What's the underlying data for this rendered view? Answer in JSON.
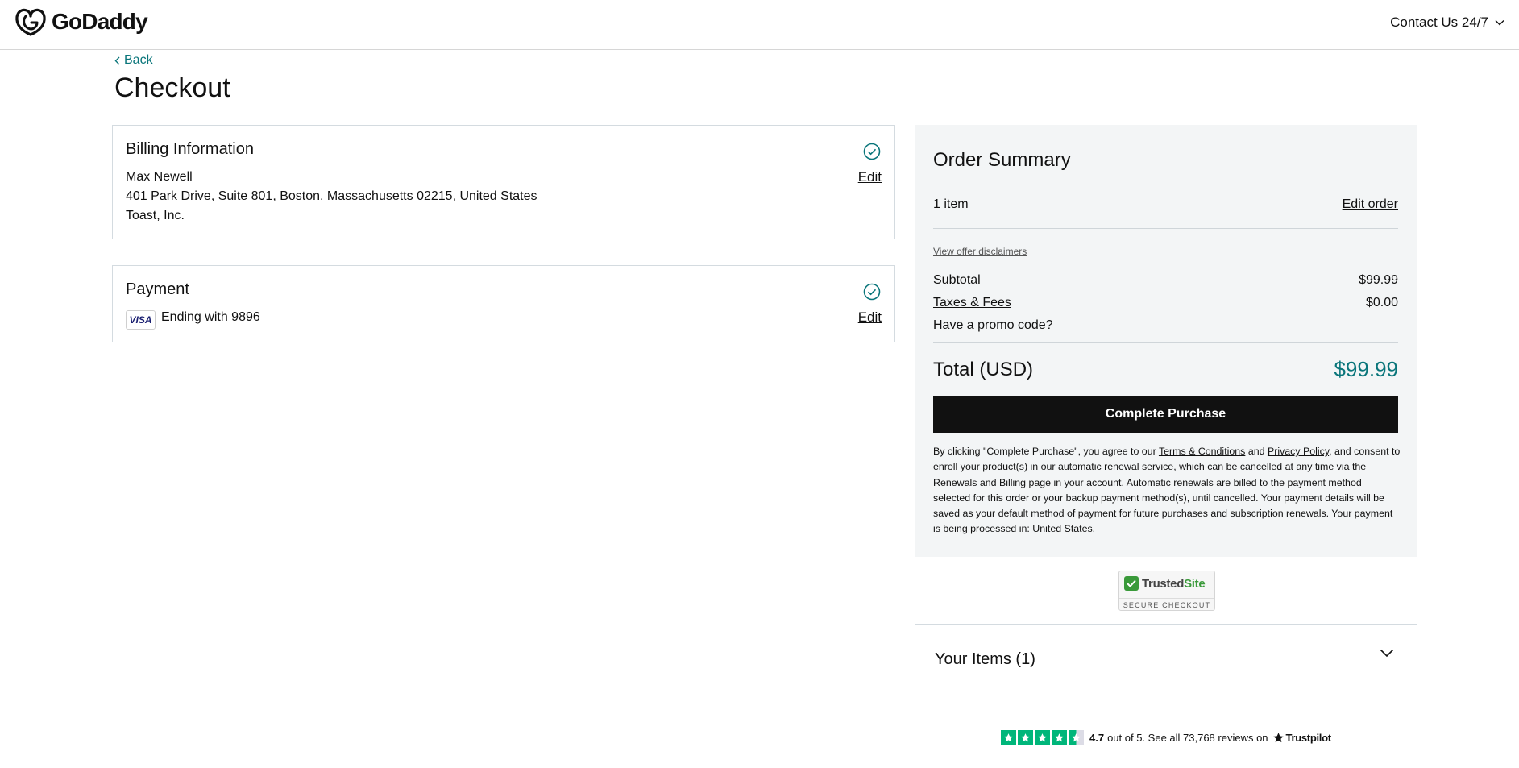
{
  "header": {
    "brand": "GoDaddy",
    "contact_label": "Contact Us 24/7",
    "icons": {
      "logo": "godaddy-logo-icon",
      "contact_dropdown": "chevron-down-icon"
    }
  },
  "nav": {
    "back_label": "Back"
  },
  "page": {
    "title": "Checkout"
  },
  "billing": {
    "title": "Billing Information",
    "name": "Max Newell",
    "address": "401 Park Drive, Suite 801, Boston, Massachusetts 02215, United States",
    "company": "Toast, Inc.",
    "edit_label": "Edit",
    "status_icon": "check-circle-icon"
  },
  "payment": {
    "title": "Payment",
    "card_brand": "VISA",
    "card_text": "Ending with 9896",
    "edit_label": "Edit",
    "status_icon": "check-circle-icon"
  },
  "summary": {
    "title": "Order Summary",
    "item_count": "1 item",
    "edit_order_label": "Edit order",
    "disclaimers_label": "View offer disclaimers",
    "subtotal_label": "Subtotal",
    "subtotal_value": "$99.99",
    "taxes_label": "Taxes & Fees",
    "taxes_value": "$0.00",
    "promo_label": "Have a promo code?",
    "total_label": "Total (USD)",
    "total_value": "$99.99",
    "complete_label": "Complete Purchase",
    "legal": {
      "part1": "By clicking \"Complete Purchase\", you agree to our ",
      "terms_link": "Terms & Conditions",
      "part2": " and ",
      "privacy_link": "Privacy Policy",
      "part3": ", and consent to enroll your product(s) in our automatic renewal service, which can be cancelled at any time via the Renewals and Billing page in your account. Automatic renewals are billed to the payment method selected for this order or your backup payment method(s), until cancelled. Your payment details will be saved as your default method of payment for future purchases and subscription renewals. Your payment is being processed in: United States."
    },
    "colors": {
      "accent": "#09757a",
      "button": "#111111",
      "panel_bg": "#f3f5f6"
    }
  },
  "trusted_site": {
    "name_part1": "Trusted",
    "name_part2": "Site",
    "tagline": "SECURE CHECKOUT"
  },
  "your_items": {
    "title": "Your Items (1)",
    "toggle_icon": "chevron-down-icon"
  },
  "trustpilot": {
    "rating": "4.7",
    "text": "out of 5. See all 73,768 reviews on",
    "brand": "Trustpilot",
    "stars": 4.5
  }
}
